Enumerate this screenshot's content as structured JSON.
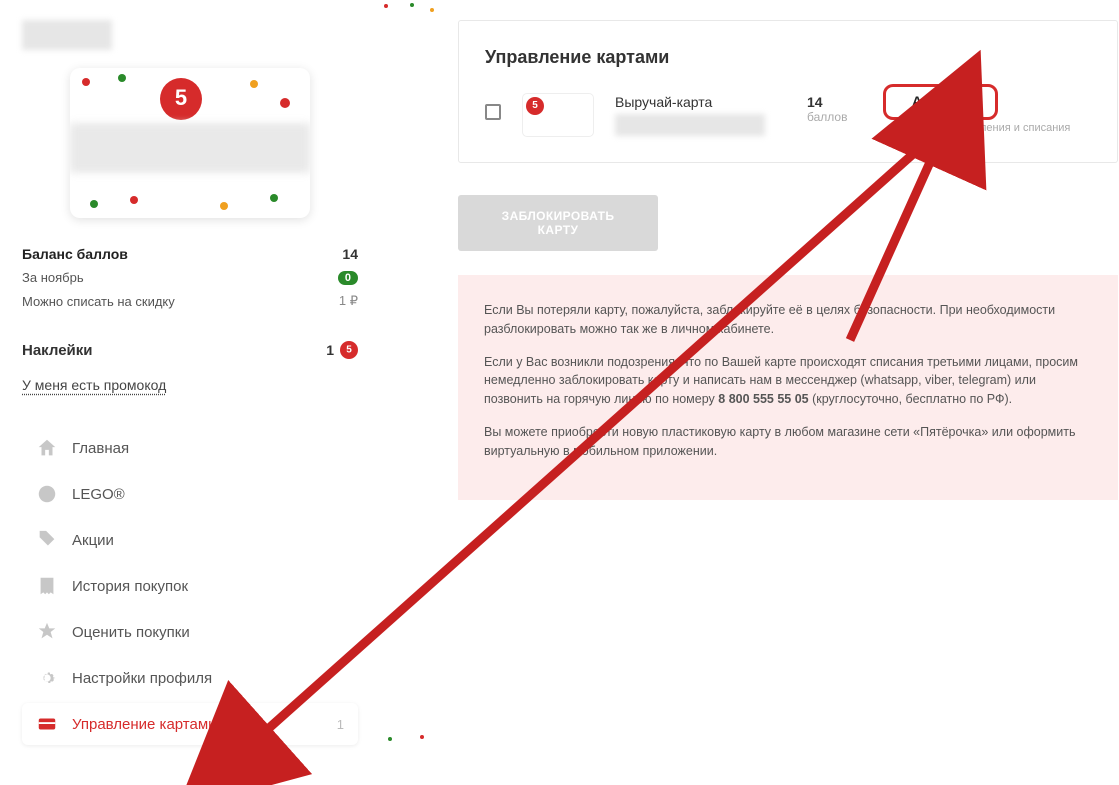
{
  "user": {
    "name_placeholder": ""
  },
  "balance": {
    "label": "Баланс баллов",
    "value": "14",
    "month_label": "За ноябрь",
    "month_badge": "0",
    "discount_label": "Можно списать на скидку",
    "discount_value": "1 ₽"
  },
  "stickers": {
    "label": "Наклейки",
    "count": "1"
  },
  "promo_link": "У меня есть промокод",
  "nav": {
    "home": "Главная",
    "lego": "LEGO®",
    "promo": "Акции",
    "history": "История покупок",
    "rate": "Оценить покупки",
    "settings": "Настройки профиля",
    "cards": "Управление картами",
    "cards_count": "1"
  },
  "main": {
    "heading": "Управление картами",
    "card": {
      "name": "Выручай-карта",
      "points": "14",
      "points_label": "баллов",
      "status": "Активна",
      "status_sub": "доступны начисления и списания"
    },
    "block_button": "ЗАБЛОКИРОВАТЬ КАРТУ",
    "info": {
      "p1": "Если Вы потеряли карту, пожалуйста, заблокируйте её в целях безопасности. При необходимости разблокировать можно так же в личном кабинете.",
      "p2a": "Если у Вас возникли подозрения, что по Вашей карте происходят списания третьими лицами, просим немедленно заблокировать карту и написать нам в мессенджер (whatsapp, viber, telegram) или позвонить на горячую линию по номеру ",
      "phone": "8 800 555 55 05",
      "p2b": " (круглосуточно, бесплатно по РФ).",
      "p3": "Вы можете приобрести новую пластиковую карту в любом магазине сети «Пятёрочка» или оформить виртуальную в мобильном приложении."
    }
  }
}
